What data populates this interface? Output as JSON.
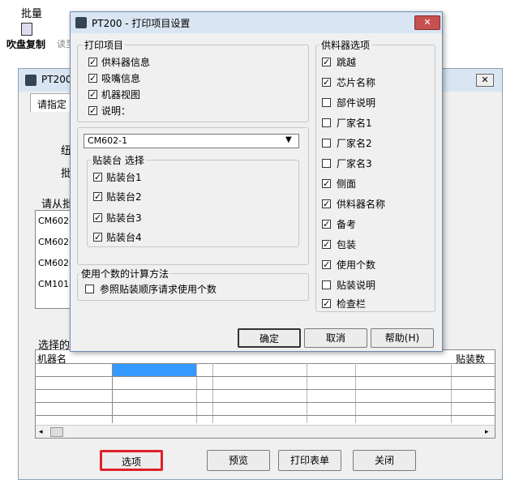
{
  "app_toolbar": {
    "item_batch": "批量",
    "item_copy": "吹盘复制",
    "item_other": "读至"
  },
  "bg_window": {
    "title": "PT200",
    "tab_hint": "请指定",
    "side_label_1": "纽",
    "side_label_2": "批",
    "list_label": "请从批",
    "list_items": [
      "CM602-",
      "CM602-",
      "CM602-",
      "CM101-"
    ],
    "selected_label": "选择的",
    "table_header_left": "机器名",
    "table_header_right": "贴装数",
    "buttons": {
      "options": "选项",
      "preview": "预览",
      "print_list": "打印表单",
      "close": "关闭"
    }
  },
  "dialog": {
    "title": "PT200 - 打印项目设置",
    "print_items": {
      "group_title": "打印项目",
      "items": [
        {
          "label": "供料器信息",
          "checked": true
        },
        {
          "label": "吸嘴信息",
          "checked": true
        },
        {
          "label": "机器视图",
          "checked": true
        },
        {
          "label": "说明：",
          "checked": true
        }
      ]
    },
    "machine_select": {
      "value": "CM602-1"
    },
    "placement_group": {
      "title": "贴装台 选择",
      "items": [
        {
          "label": "贴装台1",
          "checked": true
        },
        {
          "label": "贴装台2",
          "checked": true
        },
        {
          "label": "贴装台3",
          "checked": true
        },
        {
          "label": "贴装台4",
          "checked": true
        }
      ]
    },
    "count_method": {
      "title": "使用个数的计算方法",
      "option": {
        "label": "参照贴装顺序请求使用个数",
        "checked": false
      }
    },
    "feeder_options": {
      "group_title": "供料器选项",
      "items": [
        {
          "label": "跳越",
          "checked": true
        },
        {
          "label": "芯片名称",
          "checked": true
        },
        {
          "label": "部件说明",
          "checked": false
        },
        {
          "label": "厂家名1",
          "checked": false
        },
        {
          "label": "厂家名2",
          "checked": false
        },
        {
          "label": "厂家名3",
          "checked": false
        },
        {
          "label": "侧面",
          "checked": true
        },
        {
          "label": "供料器名称",
          "checked": true
        },
        {
          "label": "备考",
          "checked": true
        },
        {
          "label": "包装",
          "checked": true
        },
        {
          "label": "使用个数",
          "checked": true
        },
        {
          "label": "贴装说明",
          "checked": false
        },
        {
          "label": "检查栏",
          "checked": true
        }
      ]
    },
    "buttons": {
      "ok": "确定",
      "cancel": "取消",
      "help": "帮助(H)"
    }
  },
  "colors": {
    "dialog_bg": "#f0f0f0",
    "titlebar": "#d9e5f2",
    "close_red": "#c75050",
    "selection_blue": "#3399ff",
    "highlight_red": "#e0202a"
  }
}
